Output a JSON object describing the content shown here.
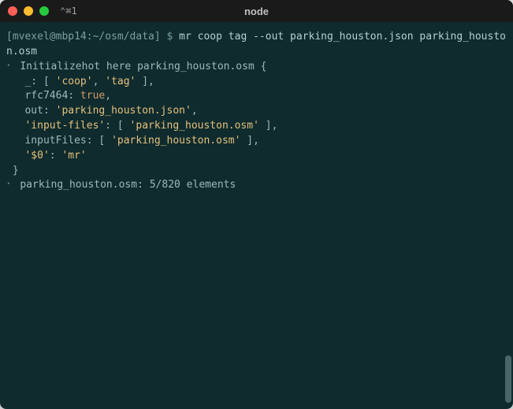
{
  "window": {
    "tab_label": "⌃⌘1",
    "title": "node"
  },
  "prompt": {
    "user_host": "[mvexel@mbp14:",
    "path": "~/osm/data",
    "end": "] $ "
  },
  "command": "mr coop tag --out parking_houston.json parking_houston.osm",
  "output": {
    "gutter_prefix": "⠂",
    "init_line": "Initializehot here parking_houston.osm {",
    "lines": [
      {
        "indent": "  ",
        "key": "_:",
        "value": "[ 'coop', 'tag' ]",
        "trailing": ","
      },
      {
        "indent": "  ",
        "key": "rfc7464:",
        "value_bool": "true",
        "trailing": ","
      },
      {
        "indent": "  ",
        "key": "out:",
        "value": "'parking_houston.json'",
        "trailing": ","
      },
      {
        "indent": "  ",
        "key_str": "'input-files'",
        "value": "[ 'parking_houston.osm' ]",
        "trailing": ","
      },
      {
        "indent": "  ",
        "key": "inputFiles:",
        "value": "[ 'parking_houston.osm' ]",
        "trailing": ","
      },
      {
        "indent": "  ",
        "key_str": "'$0'",
        "value": "'mr'",
        "trailing": ""
      }
    ],
    "close_brace": "}",
    "status_line": "parking_houston.osm: 5/820 elements"
  }
}
